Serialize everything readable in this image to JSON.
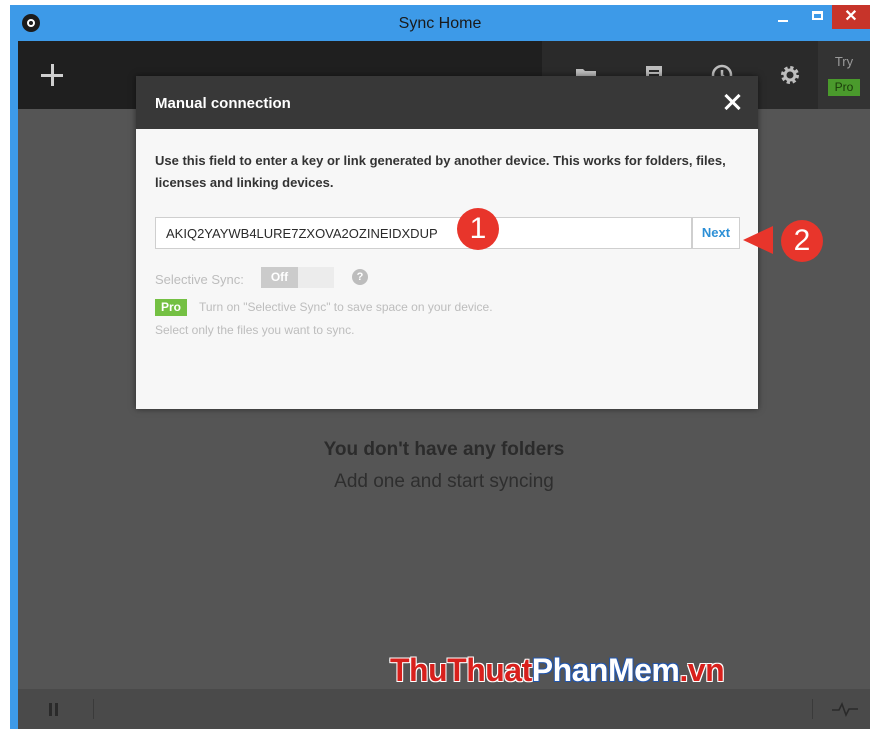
{
  "window": {
    "title": "Sync Home",
    "close_glyph": "✕"
  },
  "toolbar": {
    "try_label": "Try",
    "pro_label": "Pro",
    "icons": [
      "add-icon",
      "folder-icon",
      "transfers-icon",
      "history-icon",
      "gear-icon"
    ]
  },
  "main": {
    "empty_title": "You don't have any folders",
    "empty_subtitle": "Add one and start syncing"
  },
  "dialog": {
    "title": "Manual connection",
    "description": "Use this field to enter a key or link generated by another device. This works for folders, files, licenses and linking devices.",
    "key_value": "AKIQ2YAYWB4LURE7ZXOVA2OZINEIDXDUP",
    "next_label": "Next",
    "selective_sync_label": "Selective Sync:",
    "toggle_off_label": "Off",
    "help_glyph": "?",
    "pro_badge": "Pro",
    "pro_text": "Turn on \"Selective Sync\" to save space on your device.",
    "pro_text2": "Select only the files you want to sync."
  },
  "annotations": {
    "marker_1": "1",
    "marker_2": "2"
  },
  "watermark": {
    "part1": "ThuThuat",
    "part2": "PhanMem",
    "part3": ".vn"
  },
  "colors": {
    "titlebar": "#3d9ae8",
    "close_red": "#c7342a",
    "accent_blue": "#2c8fd6",
    "pro_green": "#74c043",
    "marker_red": "#e8352b"
  }
}
